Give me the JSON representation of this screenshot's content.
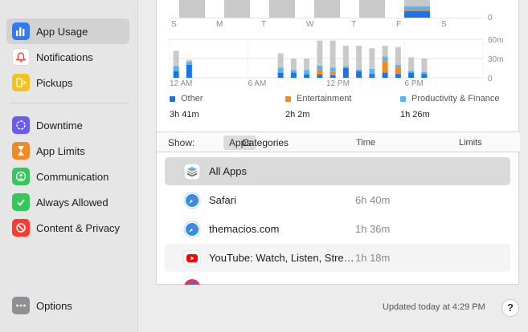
{
  "sidebar": {
    "items": [
      {
        "label": "App Usage",
        "icon": "bar-chart-icon",
        "color": "#2d7cf6"
      },
      {
        "label": "Notifications",
        "icon": "bell-icon",
        "color": "#f0f0f0"
      },
      {
        "label": "Pickups",
        "icon": "pickups-icon",
        "color": "#f5c21b"
      },
      {
        "label": "Downtime",
        "icon": "downtime-icon",
        "color": "#6b5cf0"
      },
      {
        "label": "App Limits",
        "icon": "hourglass-icon",
        "color": "#f08a24"
      },
      {
        "label": "Communication",
        "icon": "communication-icon",
        "color": "#34c759"
      },
      {
        "label": "Always Allowed",
        "icon": "checkmark-icon",
        "color": "#34c759"
      },
      {
        "label": "Content & Privacy",
        "icon": "no-entry-icon",
        "color": "#ff3b30"
      },
      {
        "label": "Options",
        "icon": "ellipsis-icon",
        "color": "#8e8e93"
      }
    ]
  },
  "weekly_chart": {
    "day_labels": [
      "S",
      "M",
      "T",
      "W",
      "T",
      "F",
      "S"
    ],
    "y_tick": "0"
  },
  "chart_data": {
    "type": "bar",
    "stacked": true,
    "x_tick_labels": [
      "12 AM",
      "6 AM",
      "12 PM",
      "6 PM"
    ],
    "y_tick_labels": [
      "60m",
      "30m",
      "0"
    ],
    "ylim": [
      0,
      60
    ],
    "hours": [
      0,
      1,
      2,
      3,
      4,
      5,
      6,
      7,
      8,
      9,
      10,
      11,
      12,
      13,
      14,
      15,
      16,
      17,
      18,
      19,
      20,
      21,
      22,
      23
    ],
    "series": [
      {
        "name": "Other",
        "color": "#1a73e8",
        "values": [
          10,
          20,
          0,
          0,
          0,
          0,
          0,
          0,
          8,
          8,
          5,
          5,
          4,
          15,
          10,
          6,
          8,
          6,
          8,
          6,
          0,
          0,
          0,
          0
        ]
      },
      {
        "name": "Entertainment",
        "color": "#f08a24",
        "values": [
          0,
          0,
          0,
          0,
          0,
          0,
          0,
          0,
          0,
          0,
          0,
          8,
          5,
          0,
          0,
          0,
          18,
          10,
          0,
          0,
          0,
          0,
          0,
          0
        ]
      },
      {
        "name": "Productivity & Finance",
        "color": "#5ab4f0",
        "values": [
          8,
          5,
          0,
          0,
          0,
          0,
          0,
          0,
          8,
          4,
          7,
          6,
          7,
          3,
          3,
          8,
          7,
          4,
          3,
          3,
          0,
          0,
          0,
          0
        ]
      }
    ],
    "other_total": [
      42,
      28,
      0,
      0,
      0,
      0,
      0,
      0,
      38,
      30,
      30,
      58,
      58,
      50,
      50,
      46,
      50,
      48,
      32,
      30,
      0,
      0,
      0,
      0
    ]
  },
  "legend": [
    {
      "label": "Other",
      "value": "3h 41m",
      "color": "#1a73e8"
    },
    {
      "label": "Entertainment",
      "value": "2h 2m",
      "color": "#f08a24"
    },
    {
      "label": "Productivity & Finance",
      "value": "1h 26m",
      "color": "#5ab4f0"
    }
  ],
  "toolbar": {
    "show_label": "Show:",
    "apps_label": "Apps",
    "categories_label": "Categories",
    "time_header": "Time",
    "limits_header": "Limits"
  },
  "apps": [
    {
      "name": "All Apps",
      "time": "",
      "icon": "stack-icon"
    },
    {
      "name": "Safari",
      "time": "6h 40m",
      "icon": "safari-icon"
    },
    {
      "name": "themacios.com",
      "time": "1h 36m",
      "icon": "safari-icon"
    },
    {
      "name": "YouTube: Watch, Listen, Stream",
      "time": "1h 18m",
      "icon": "youtube-icon"
    }
  ],
  "footer": {
    "updated": "Updated today at 4:29 PM",
    "help": "?"
  }
}
